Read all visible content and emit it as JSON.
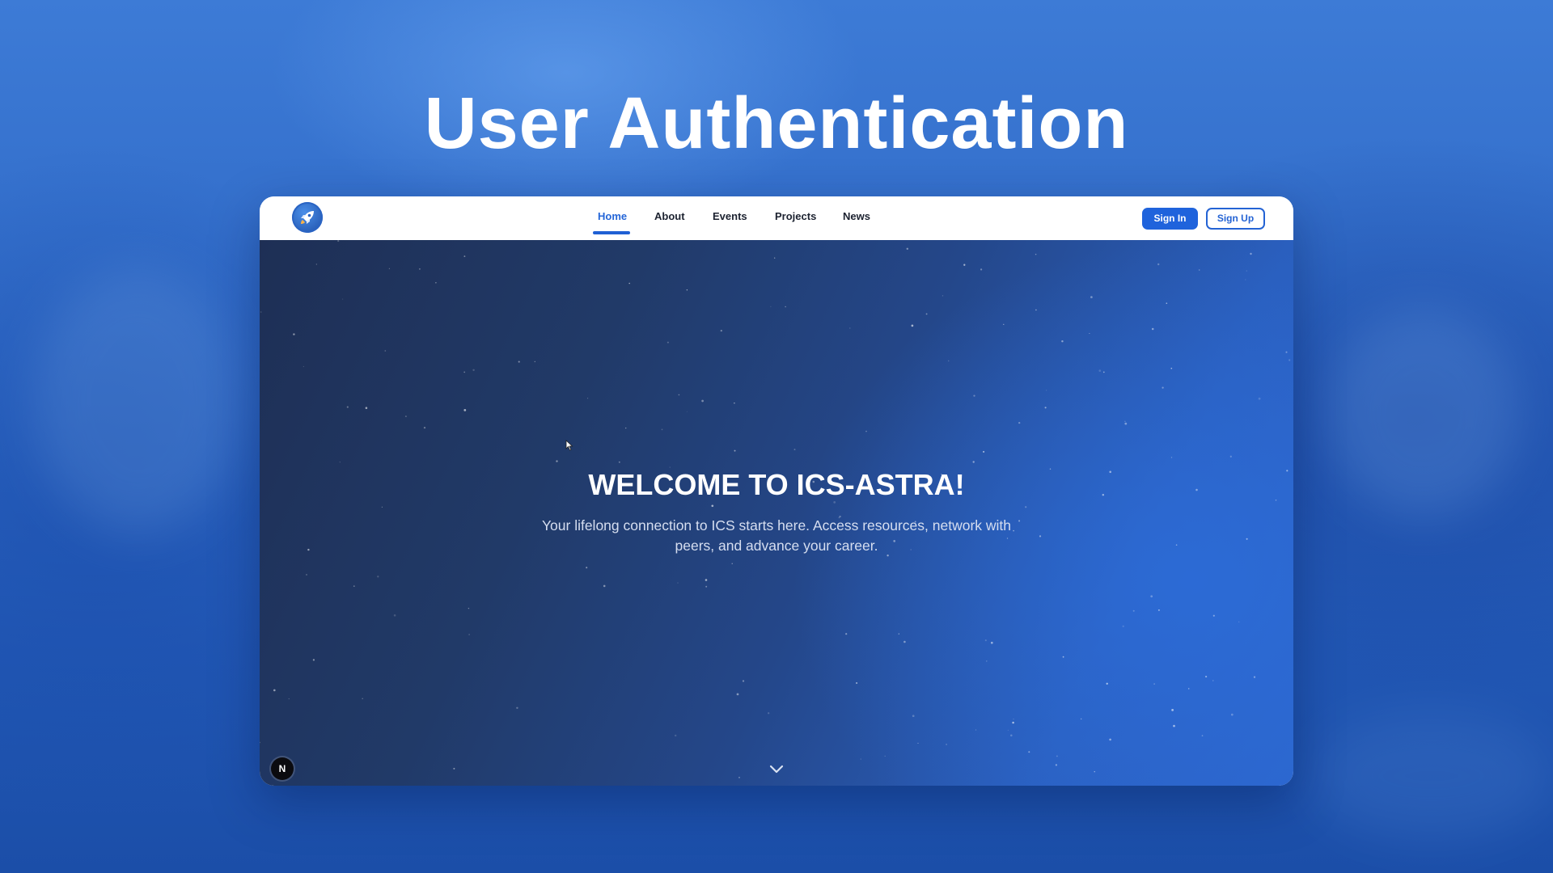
{
  "slide": {
    "title": "User Authentication"
  },
  "navbar": {
    "logo_icon": "rocket-icon",
    "items": [
      {
        "label": "Home",
        "active": true
      },
      {
        "label": "About",
        "active": false
      },
      {
        "label": "Events",
        "active": false
      },
      {
        "label": "Projects",
        "active": false
      },
      {
        "label": "News",
        "active": false
      }
    ],
    "sign_in_label": "Sign In",
    "sign_up_label": "Sign Up"
  },
  "hero": {
    "heading": "WELCOME TO ICS-ASTRA!",
    "subtitle": "Your lifelong connection to ICS starts here. Access resources, network with peers, and advance your career.",
    "scroll_icon": "chevron-down-icon"
  },
  "dev_badge": {
    "label": "N"
  },
  "colors": {
    "accent": "#1f63dc",
    "nav_active": "#2566d8",
    "background": "#2f69c6",
    "hero_dark": "#1e2f55",
    "hero_light": "#2c65cc"
  }
}
